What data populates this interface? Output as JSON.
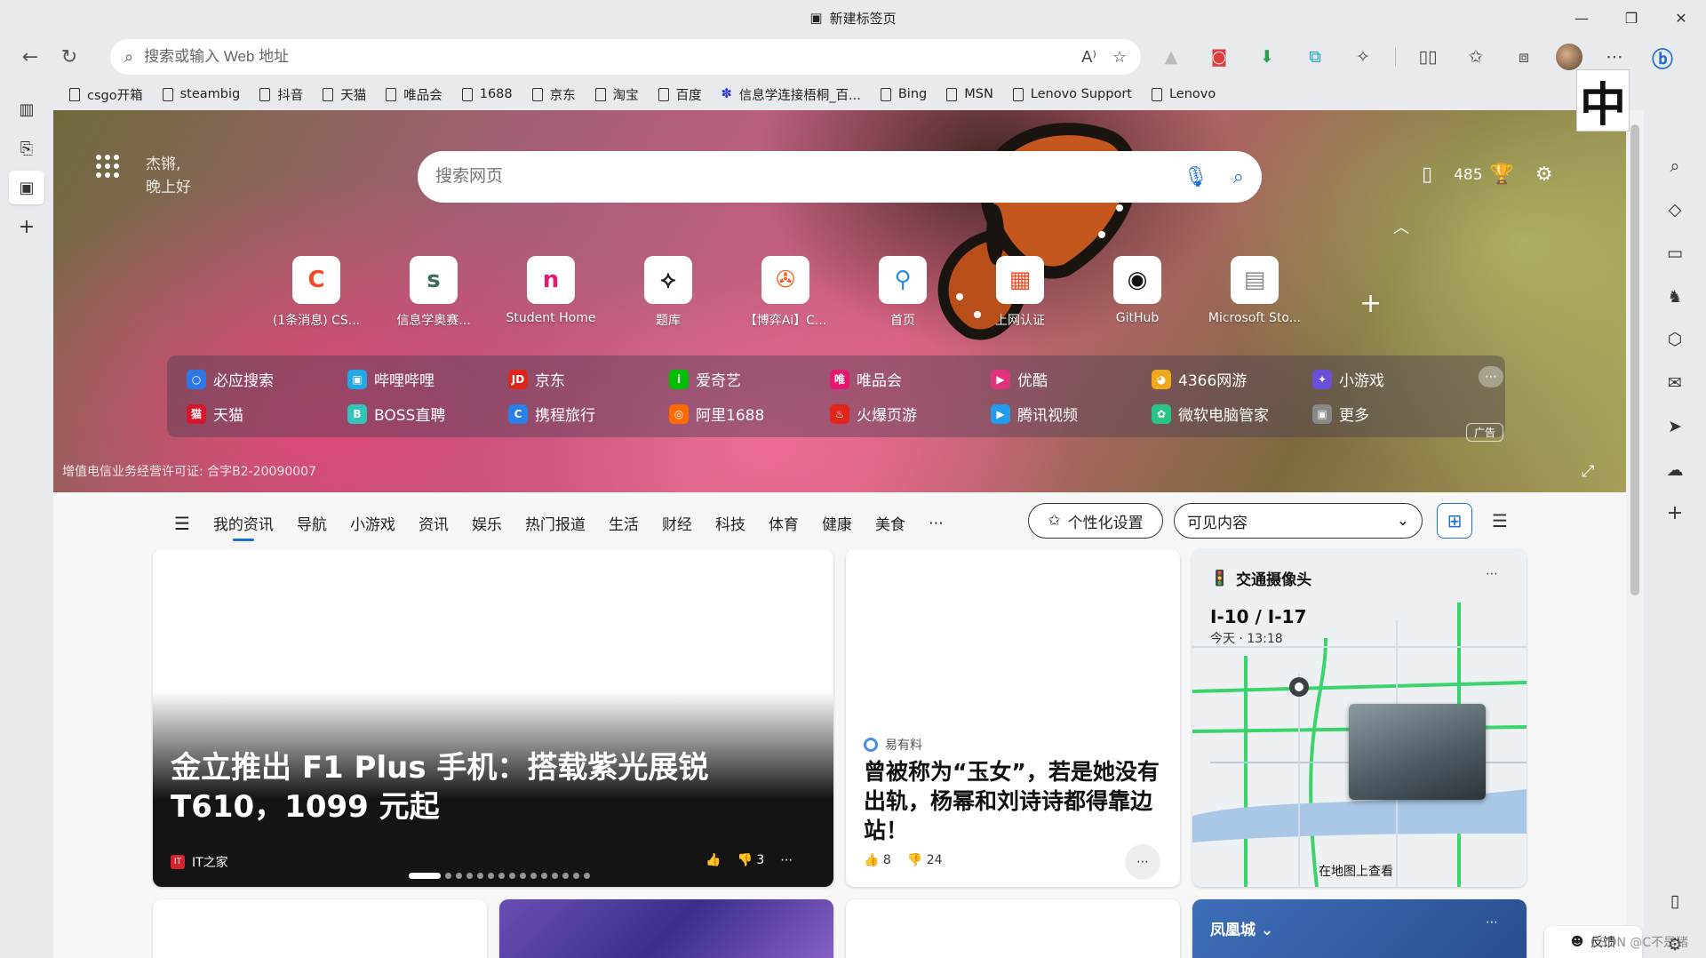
{
  "window": {
    "title": "新建标签页"
  },
  "address_bar": {
    "placeholder": "搜索或输入 Web 地址"
  },
  "favorites": [
    "csgo开箱",
    "steambig",
    "抖音",
    "天猫",
    "唯品会",
    "1688",
    "京东",
    "淘宝",
    "百度",
    "信息学连接梧桐_百...",
    "Bing",
    "MSN",
    "Lenovo Support",
    "Lenovo"
  ],
  "ime": "中",
  "greeting": {
    "name": "杰锵,",
    "text": "晚上好"
  },
  "search": {
    "placeholder": "搜索网页"
  },
  "rewards": {
    "points": "485"
  },
  "top_sites": [
    {
      "label": "(1条消息) CS...",
      "glyph": "C",
      "color": "#f24a22"
    },
    {
      "label": "信息学奥赛...",
      "glyph": "s",
      "color": "#3c6e5a"
    },
    {
      "label": "Student Home",
      "glyph": "n",
      "color": "#e5196e"
    },
    {
      "label": "题库",
      "glyph": "⟡",
      "color": "#222222"
    },
    {
      "label": "【博弈Ai】C...",
      "glyph": "✇",
      "color": "#f25a19"
    },
    {
      "label": "首页",
      "glyph": "⚲",
      "color": "#2a8fe0"
    },
    {
      "label": "上网认证",
      "glyph": "▦",
      "color": "#f25022"
    },
    {
      "label": "GitHub",
      "glyph": "◉",
      "color": "#111111"
    },
    {
      "label": "Microsoft Sto...",
      "glyph": "▤",
      "color": "#8a8a8a"
    }
  ],
  "quick_links": [
    {
      "label": "必应搜索",
      "color": "#2e77e5",
      "glyph": "○"
    },
    {
      "label": "哔哩哔哩",
      "color": "#22a8e6",
      "glyph": "▣"
    },
    {
      "label": "京东",
      "color": "#e1251b",
      "glyph": "JD"
    },
    {
      "label": "爱奇艺",
      "color": "#00be06",
      "glyph": "i"
    },
    {
      "label": "唯品会",
      "color": "#e5176e",
      "glyph": "唯"
    },
    {
      "label": "优酷",
      "color": "#e0337c",
      "glyph": "▶"
    },
    {
      "label": "4366网游",
      "color": "#f0a81c",
      "glyph": "◕"
    },
    {
      "label": "小游戏",
      "color": "#6a4fd8",
      "glyph": "✦"
    },
    {
      "label": "天猫",
      "color": "#d9142b",
      "glyph": "猫"
    },
    {
      "label": "BOSS直聘",
      "color": "#32c4b8",
      "glyph": "B"
    },
    {
      "label": "携程旅行",
      "color": "#2a7fe8",
      "glyph": "C"
    },
    {
      "label": "阿里1688",
      "color": "#ff6a00",
      "glyph": "◎"
    },
    {
      "label": "火爆页游",
      "color": "#e0251b",
      "glyph": "♨"
    },
    {
      "label": "腾讯视频",
      "color": "#1f9bf0",
      "glyph": "▶"
    },
    {
      "label": "微软电脑管家",
      "color": "#2ac48a",
      "glyph": "✿"
    },
    {
      "label": "更多",
      "color": "#888888",
      "glyph": "▣"
    }
  ],
  "ad_badge": "广告",
  "license": "增值电信业务经营许可证: 合字B2-20090007",
  "feed_nav": {
    "items": [
      "我的资讯",
      "导航",
      "小游戏",
      "资讯",
      "娱乐",
      "热门报道",
      "生活",
      "财经",
      "科技",
      "体育",
      "健康",
      "美食"
    ],
    "personalize": "个性化设置",
    "visible_content": "可见内容"
  },
  "cards": {
    "hero": {
      "headline": "金立推出 F1 Plus 手机：搭载紫光展锐 T610，1099 元起",
      "source": "IT之家",
      "likes": "",
      "dislikes": "3"
    },
    "story": {
      "source": "易有料",
      "headline": "曾被称为“玉女”，若是她没有出轨，杨幂和刘诗诗都得靠边站！",
      "likes": "8",
      "dislikes": "24"
    },
    "traffic": {
      "title": "交通摄像头",
      "route": "I-10 / I-17",
      "time": "今天 · 13:18",
      "view_map": "在地图上查看"
    },
    "weather": {
      "city": "凤凰城"
    }
  },
  "feedback": "反馈",
  "watermark": "CSDN @C不是猪"
}
